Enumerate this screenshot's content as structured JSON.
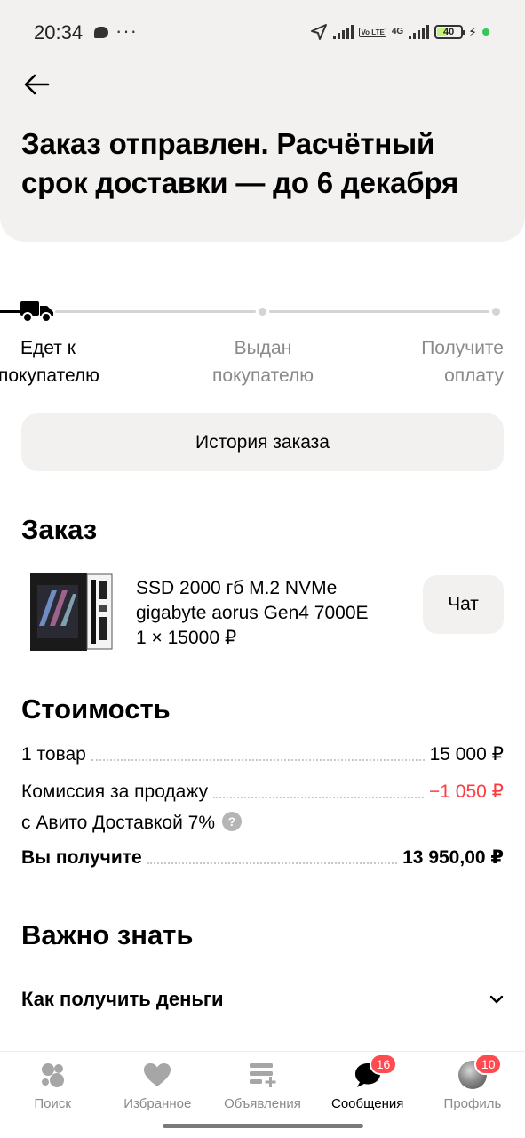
{
  "status_bar": {
    "time": "20:34",
    "more": "···",
    "network": "4G",
    "volte": "Vo LTE",
    "battery": "40"
  },
  "header": {
    "title": "Заказ отправлен. Расчётный срок доставки — до 6 декабря",
    "back_icon": "arrow-left-icon"
  },
  "progress": {
    "steps": [
      {
        "label": "Едет к покупателю",
        "state": "active"
      },
      {
        "label": "Выдан покупателю",
        "state": "pending"
      },
      {
        "label": "Получите оплату",
        "state": "pending"
      }
    ]
  },
  "history_button": "История заказа",
  "order": {
    "section_title": "Заказ",
    "item_title": "SSD 2000 гб M.2 NVMe gigabyte aorus Gen4 7000E",
    "item_qty_price": "1 × 15000 ₽",
    "chat_button": "Чат"
  },
  "cost": {
    "section_title": "Стоимость",
    "rows": [
      {
        "label": "1 товар",
        "value": "15 000 ₽"
      },
      {
        "label_line1": "Комиссия за продажу",
        "label_line2": "с Авито Доставкой 7%",
        "value": "−1 050 ₽"
      },
      {
        "label": "Вы получите",
        "value": "13 950,00 ₽"
      }
    ],
    "help_icon": "?"
  },
  "important": {
    "section_title": "Важно знать",
    "faq": [
      {
        "label": "Как получить деньги"
      }
    ]
  },
  "bottom_nav": {
    "items": [
      {
        "label": "Поиск",
        "icon": "search-icon"
      },
      {
        "label": "Избранное",
        "icon": "heart-icon"
      },
      {
        "label": "Объявления",
        "icon": "listings-icon"
      },
      {
        "label": "Сообщения",
        "icon": "chat-bubble-icon",
        "badge": "16",
        "active": true
      },
      {
        "label": "Профиль",
        "icon": "avatar",
        "badge": "10"
      }
    ]
  },
  "colors": {
    "surface": "#f2f1f0",
    "accent_red": "#ff4b4f",
    "negative": "#ff3b40",
    "muted": "#8a8a8a"
  }
}
